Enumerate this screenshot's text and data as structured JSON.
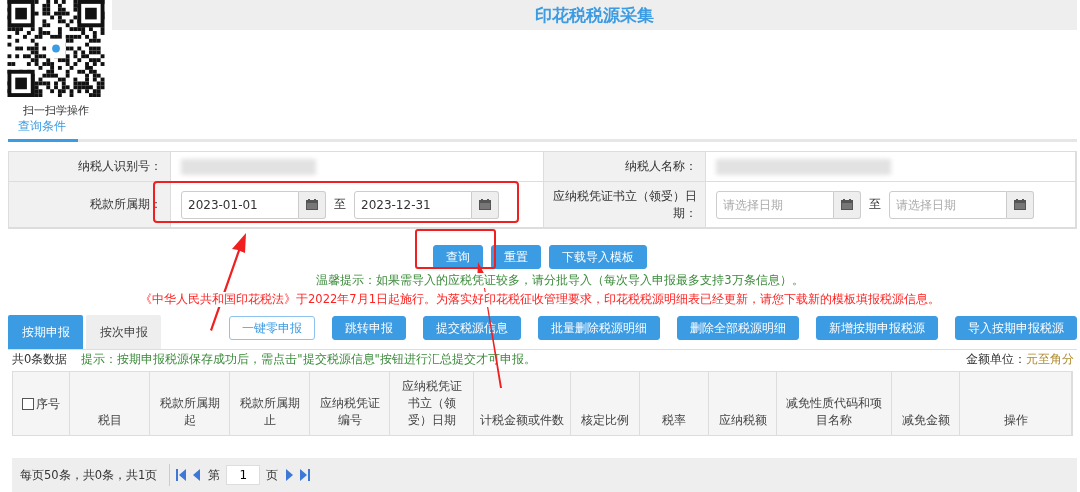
{
  "qr": {
    "caption": "扫一扫学操作"
  },
  "title": "印花税税源采集",
  "query_tab": "查询条件",
  "form": {
    "taxpayer_id_label": "纳税人识别号：",
    "taxpayer_name_label": "纳税人名称：",
    "period_label": "税款所属期：",
    "period_from": "2023-01-01",
    "period_to": "2023-12-31",
    "period_separator": "至",
    "voucher_date_label": "应纳税凭证书立（领受）日期：",
    "voucher_from_placeholder": "请选择日期",
    "voucher_to_placeholder": "请选择日期",
    "voucher_separator": "至"
  },
  "query_buttons": [
    "查询",
    "重置",
    "下载导入模板"
  ],
  "hint": "温馨提示：如果需导入的应税凭证较多，请分批导入（每次导入申报最多支持3万条信息）。",
  "notice": "《中华人民共和国印花税法》于2022年7月1日起施行。为落实好印花税征收管理要求，印花税税源明细表已经更新，请您下载新的模板填报税源信息。",
  "declare_tabs": [
    {
      "label": "按期申报",
      "selected": true
    },
    {
      "label": "按次申报",
      "selected": false
    }
  ],
  "actions": [
    {
      "label": "一键零申报",
      "kind": "outline"
    },
    {
      "label": "跳转申报",
      "kind": "solid"
    },
    {
      "label": "提交税源信息",
      "kind": "solid"
    },
    {
      "label": "批量删除税源明细",
      "kind": "solid"
    },
    {
      "label": "删除全部税源明细",
      "kind": "solid"
    },
    {
      "label": "新增按期申报税源",
      "kind": "solid"
    },
    {
      "label": "导入按期申报税源",
      "kind": "solid"
    }
  ],
  "count": "共0条数据",
  "tip": "提示：按期申报税源保存成功后，需点击\"提交税源信息\"按钮进行汇总提交才可申报。",
  "unit_label": "金额单位：",
  "unit_value": "元至角分",
  "table": {
    "select_all_checked": false,
    "columns": [
      "序号",
      "税目",
      "税款所属期起",
      "税款所属期止",
      "应纳税凭证编号",
      "应纳税凭证书立（领受）日期",
      "计税金额或件数",
      "核定比例",
      "税率",
      "应纳税额",
      "减免性质代码和项目名称",
      "减免金额",
      "操作"
    ]
  },
  "pagination": {
    "summary": "每页50条，共0条，共1页",
    "page_prefix": "第",
    "page": "1",
    "page_suffix": "页"
  }
}
